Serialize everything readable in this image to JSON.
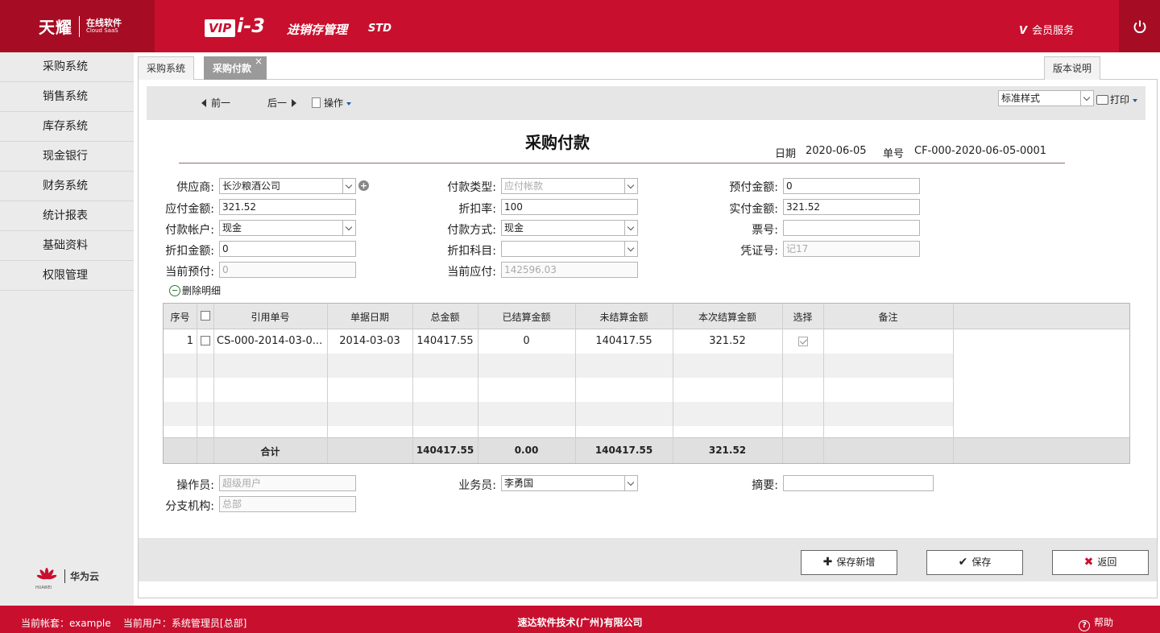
{
  "header": {
    "logo_main": "天耀",
    "logo_sub_cn": "在线软件",
    "logo_sub_en": "Cloud SaaS",
    "vip": "VIP",
    "version": "i-3",
    "product": "进销存管理",
    "edition": "STD",
    "member_v": "V",
    "member": "会员服务",
    "power_icon": "power-icon",
    "brand_color": "#c8102e"
  },
  "sidebar": {
    "items": [
      {
        "label": "采购系统"
      },
      {
        "label": "销售系统"
      },
      {
        "label": "库存系统"
      },
      {
        "label": "现金银行"
      },
      {
        "label": "财务系统"
      },
      {
        "label": "统计报表"
      },
      {
        "label": "基础资料"
      },
      {
        "label": "权限管理"
      }
    ],
    "partner": "华为云",
    "partner_sub": "HUAWEI"
  },
  "tabs": [
    {
      "label": "采购系统"
    },
    {
      "label": "采购付款",
      "close": "×"
    }
  ],
  "version_note": "版本说明",
  "toolbar": {
    "prev": "前一",
    "next": "后一",
    "ops": "操作",
    "style_select": "标准样式",
    "print": "打印"
  },
  "doc": {
    "title": "采购付款",
    "date_label": "日期",
    "date": "2020-06-05",
    "no_label": "单号",
    "no": "CF-000-2020-06-05-0001"
  },
  "form": {
    "supplier_label": "供应商:",
    "supplier": "长沙粮酒公司",
    "payable_label": "应付金额:",
    "payable": "321.52",
    "account_label": "付款帐户:",
    "account": "现金",
    "discount_amt_label": "折扣金额:",
    "discount_amt": "0",
    "cur_prepay_label": "当前预付:",
    "cur_prepay": "0",
    "pay_type_label": "付款类型:",
    "pay_type": "应付帐款",
    "discount_rate_label": "折扣率:",
    "discount_rate": "100",
    "pay_method_label": "付款方式:",
    "pay_method": "现金",
    "discount_subject_label": "折扣科目:",
    "discount_subject": "",
    "cur_payable_label": "当前应付:",
    "cur_payable": "142596.03",
    "prepay_amt_label": "预付金额:",
    "prepay_amt": "0",
    "actual_amt_label": "实付金额:",
    "actual_amt": "321.52",
    "ticket_label": "票号:",
    "ticket": "",
    "voucher_label": "凭证号:",
    "voucher": "记17",
    "delete_detail": "删除明细"
  },
  "grid": {
    "headers": [
      "序号",
      "",
      "引用单号",
      "单据日期",
      "总金额",
      "已结算金额",
      "未结算金额",
      "本次结算金额",
      "选择",
      "备注"
    ],
    "rows": [
      {
        "seq": "1",
        "ref": "CS-000-2014-03-0...",
        "date": "2014-03-03",
        "total": "140417.55",
        "settled": "0",
        "unsettled": "140417.55",
        "this": "321.52",
        "selected": true,
        "remark": ""
      }
    ],
    "footer": {
      "label": "合计",
      "total": "140417.55",
      "settled": "0.00",
      "unsettled": "140417.55",
      "this": "321.52"
    }
  },
  "bottom": {
    "operator_label": "操作员:",
    "operator": "超级用户",
    "branch_label": "分支机构:",
    "branch": "总部",
    "salesman_label": "业务员:",
    "salesman": "李勇国",
    "summary_label": "摘要:",
    "summary": ""
  },
  "buttons": {
    "save_new": "保存新增",
    "save": "保存",
    "back": "返回"
  },
  "footer": {
    "account_info": "当前帐套：example    当前用户：系统管理员[总部]",
    "company": "速达软件技术(广州)有限公司",
    "help": "帮助"
  }
}
